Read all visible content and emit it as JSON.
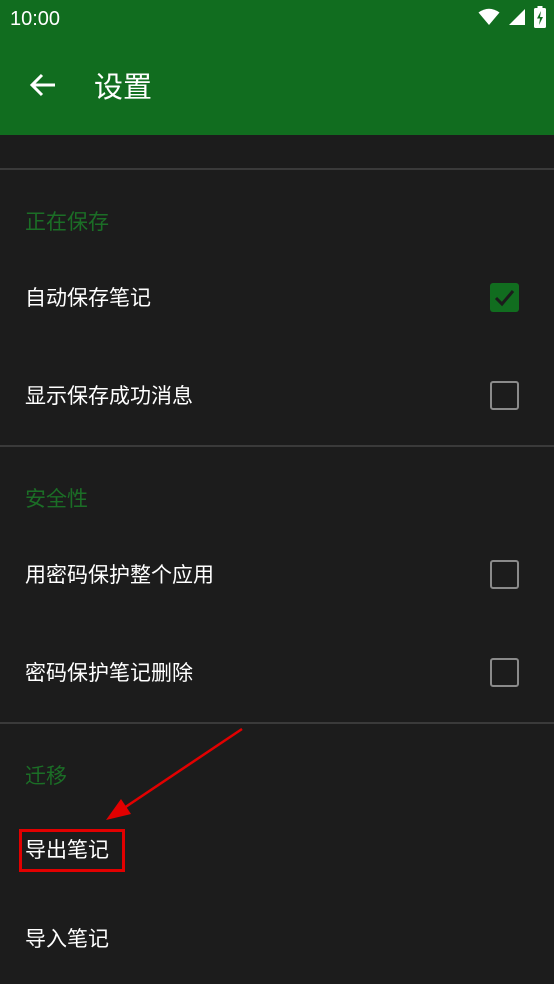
{
  "status_bar": {
    "time": "10:00",
    "icons": [
      "wifi-icon",
      "cellular-signal-icon",
      "battery-charging-icon"
    ]
  },
  "app_bar": {
    "back_icon": "arrow-back-icon",
    "title": "设置"
  },
  "colors": {
    "app_bar": "#116d1f",
    "background": "#1c1c1c",
    "section_header": "#1b6e26",
    "accent": "#116d1f",
    "annotation": "#e20000"
  },
  "sections": [
    {
      "header": "正在保存",
      "items": [
        {
          "label": "自动保存笔记",
          "checked": true
        },
        {
          "label": "显示保存成功消息",
          "checked": false
        }
      ]
    },
    {
      "header": "安全性",
      "items": [
        {
          "label": "用密码保护整个应用",
          "checked": false
        },
        {
          "label": "密码保护笔记删除",
          "checked": false
        }
      ]
    },
    {
      "header": "迁移",
      "items": [
        {
          "label": "导出笔记"
        },
        {
          "label": "导入笔记"
        }
      ]
    }
  ]
}
